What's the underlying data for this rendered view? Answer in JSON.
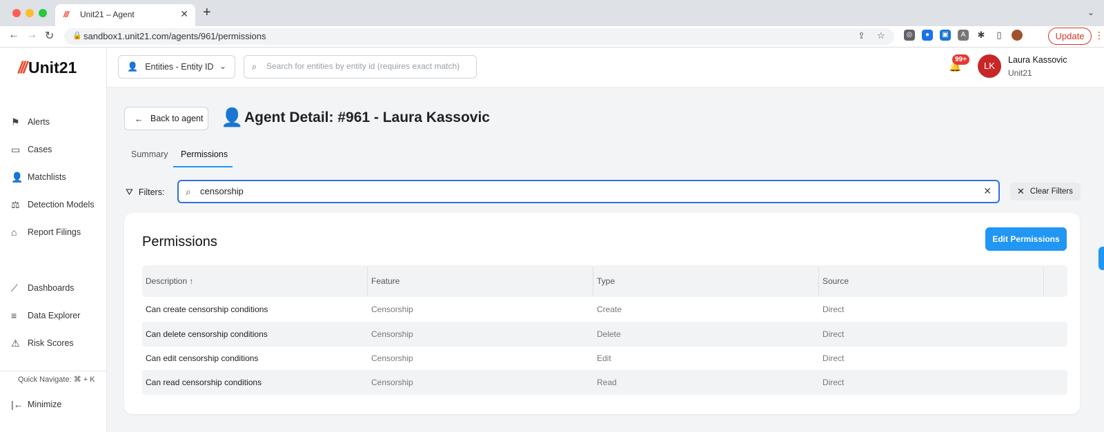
{
  "browser": {
    "tab_title": "Unit21 – Agent",
    "url": "sandbox1.unit21.com/agents/961/permissions",
    "update_label": "Update"
  },
  "sidebar": {
    "logo_text": "Unit21",
    "items": [
      {
        "label": "Alerts",
        "icon": "flag-icon"
      },
      {
        "label": "Cases",
        "icon": "briefcase-icon"
      },
      {
        "label": "Matchlists",
        "icon": "user-x-icon"
      },
      {
        "label": "Detection Models",
        "icon": "scale-icon"
      },
      {
        "label": "Report Filings",
        "icon": "bank-icon"
      },
      {
        "label": "Dashboards",
        "icon": "chart-line-icon"
      },
      {
        "label": "Data Explorer",
        "icon": "list-search-icon"
      },
      {
        "label": "Risk Scores",
        "icon": "warning-icon"
      }
    ],
    "quick_navigate": "Quick Navigate: ⌘ + K",
    "minimize_label": "Minimize"
  },
  "header": {
    "entity_select": "Entities - Entity ID",
    "search_placeholder": "Search for entities by entity id (requires exact match)",
    "notification_badge": "99+",
    "avatar_initials": "LK",
    "user_name": "Laura Kassovic",
    "user_org": "Unit21"
  },
  "page": {
    "back_label": "Back to agent",
    "title": "Agent Detail: #961 - Laura Kassovic",
    "tabs": [
      "Summary",
      "Permissions"
    ],
    "active_tab": "Permissions",
    "filters_label": "Filters:",
    "filter_value": "censorship",
    "clear_filters_label": "Clear Filters"
  },
  "permissions": {
    "title": "Permissions",
    "edit_label": "Edit Permissions",
    "columns": [
      "Description",
      "Feature",
      "Type",
      "Source"
    ],
    "rows": [
      [
        "Can create censorship conditions",
        "Censorship",
        "Create",
        "Direct"
      ],
      [
        "Can delete censorship conditions",
        "Censorship",
        "Delete",
        "Direct"
      ],
      [
        "Can edit censorship conditions",
        "Censorship",
        "Edit",
        "Direct"
      ],
      [
        "Can read censorship conditions",
        "Censorship",
        "Read",
        "Direct"
      ]
    ]
  },
  "colors": {
    "accent": "#2196f3",
    "brand": "#e8492d",
    "avatar": "#c62828"
  }
}
